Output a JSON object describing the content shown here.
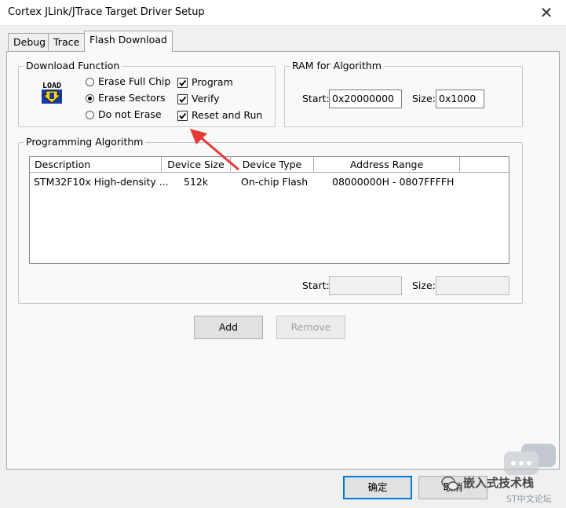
{
  "window": {
    "title": "Cortex JLink/JTrace Target Driver Setup",
    "close_glyph": "✕"
  },
  "tabs": [
    {
      "label": "Debug",
      "active": false
    },
    {
      "label": "Trace",
      "active": false
    },
    {
      "label": "Flash Download",
      "active": true
    }
  ],
  "download_function": {
    "title": "Download Function",
    "icon": "load-icon",
    "icon_text": "LOAD",
    "radios": [
      {
        "label": "Erase Full Chip",
        "selected": false
      },
      {
        "label": "Erase Sectors",
        "selected": true
      },
      {
        "label": "Do not Erase",
        "selected": false
      }
    ],
    "checks": [
      {
        "label": "Program",
        "checked": true
      },
      {
        "label": "Verify",
        "checked": true
      },
      {
        "label": "Reset and Run",
        "checked": true
      }
    ]
  },
  "ram": {
    "title": "RAM for Algorithm",
    "start_label": "Start:",
    "start_value": "0x20000000",
    "size_label": "Size:",
    "size_value": "0x1000"
  },
  "programming": {
    "title": "Programming Algorithm",
    "columns": [
      "Description",
      "Device Size",
      "Device Type",
      "Address Range"
    ],
    "rows": [
      {
        "description": "STM32F10x High-density ...",
        "size": "512k",
        "type": "On-chip Flash",
        "range": "08000000H - 0807FFFFH"
      }
    ],
    "start_label": "Start:",
    "start_value": "",
    "size_label": "Size:",
    "size_value": ""
  },
  "buttons": {
    "add": "Add",
    "remove": "Remove",
    "ok": "确定",
    "cancel": "取消"
  },
  "watermark": {
    "text": "嵌入式技术栈",
    "sub": "ST中文论坛"
  },
  "colors": {
    "annotation_arrow": "#e53935",
    "default_button_border": "#0078d7"
  }
}
